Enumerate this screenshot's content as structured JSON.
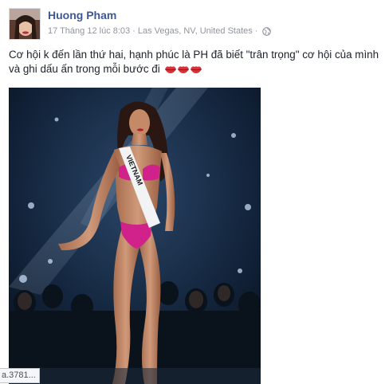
{
  "post": {
    "author": "Huong Pham",
    "timestamp": "17 Tháng 12 lúc 8:03",
    "separator": "·",
    "location": "Las Vegas, NV, United States",
    "privacy_icon": "globe-icon",
    "text": "Cơ hội k đến lần thứ hai, hạnh phúc là PH đã biết \"trân trọng\" cơ hội của mình và ghi dấu ấn trong mỗi bước đi",
    "emoji": [
      "kiss-lips-icon",
      "kiss-lips-icon",
      "kiss-lips-icon"
    ],
    "photo_sash_text": "VIETNAM"
  },
  "status_bar": {
    "url_text": "a.3781..."
  },
  "colors": {
    "author_link": "#3b5998",
    "meta_text": "#90949c",
    "body_text": "#1d2129",
    "bikini": "#d0228a",
    "stage_bg": "#0c1624"
  }
}
